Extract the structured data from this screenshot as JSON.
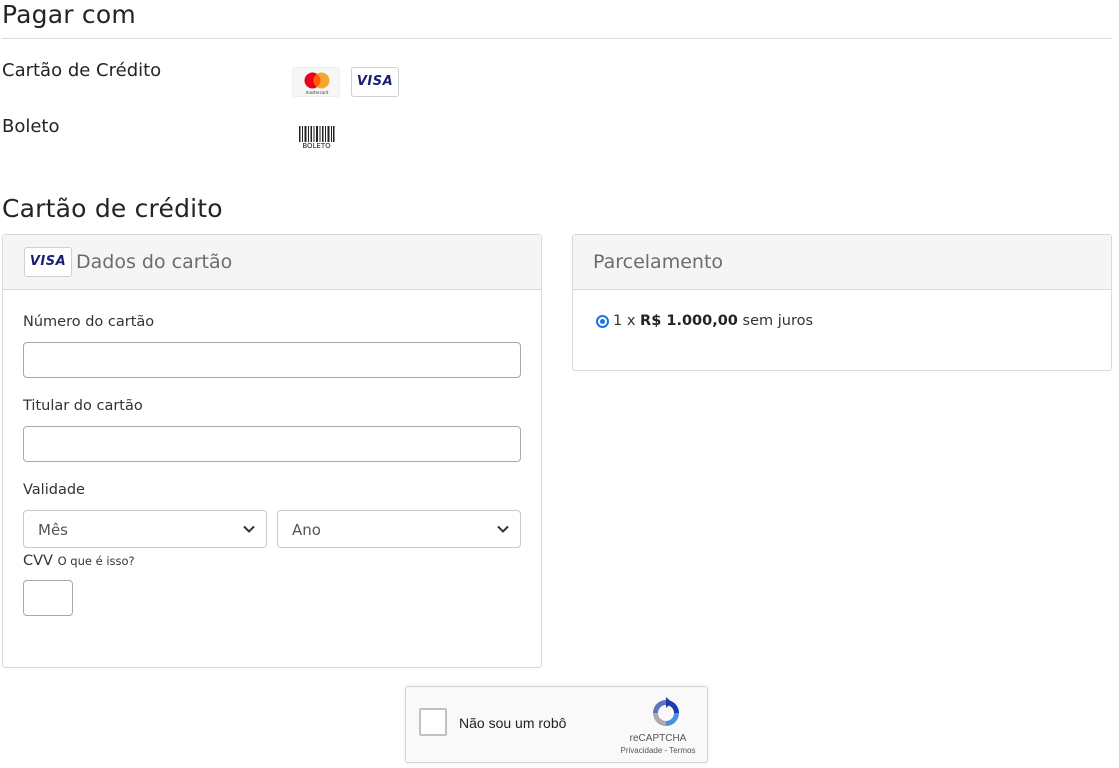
{
  "pay_with": {
    "title": "Pagar com",
    "options": [
      {
        "label": "Cartão de Crédito",
        "logos": [
          "mastercard-logo",
          "visa-logo"
        ]
      },
      {
        "label": "Boleto",
        "logos": [
          "boleto-logo"
        ]
      }
    ],
    "mastercard_text": "mastercard",
    "visa_text": "VISA",
    "boleto_text": "BOLETO"
  },
  "credit_card": {
    "title": "Cartão de crédito",
    "card_data_panel": {
      "header": "Dados do cartão",
      "visa_text": "VISA",
      "number_label": "Número do cartão",
      "number_value": "",
      "holder_label": "Titular do cartão",
      "holder_value": "",
      "validity_label": "Validade",
      "month_selected": "Mês",
      "year_selected": "Ano",
      "cvv_label": "CVV",
      "cvv_help": "O que é isso?",
      "cvv_value": ""
    },
    "installments_panel": {
      "header": "Parcelamento",
      "option": {
        "count": "1",
        "times": "x",
        "amount": "R$ 1.000,00",
        "suffix": "sem juros",
        "selected": true
      }
    }
  },
  "recaptcha": {
    "label": "Não sou um robô",
    "brand": "reCAPTCHA",
    "privacy": "Privacidade",
    "separator": "-",
    "terms": "Termos"
  },
  "colors": {
    "visa_blue": "#1a1f71",
    "mastercard_red": "#eb001b",
    "mastercard_orange": "#f79e1b",
    "radio_blue": "#1a73e8",
    "recaptcha_blue": "#1c3aa9"
  }
}
